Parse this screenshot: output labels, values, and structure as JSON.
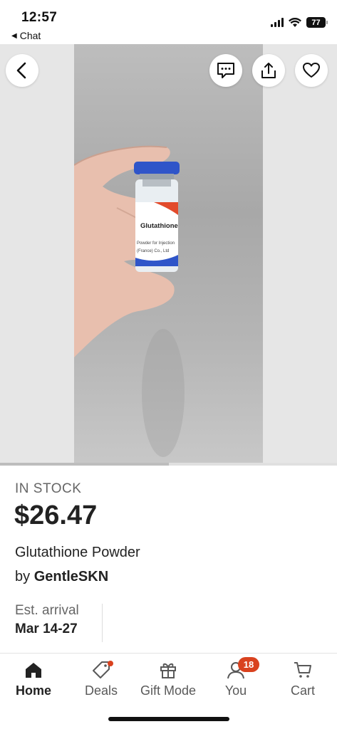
{
  "status_bar": {
    "time": "12:57",
    "back_app": "Chat",
    "battery": "77"
  },
  "hero": {
    "product_label": "Glutathione",
    "label_line1": "Powder for Injection",
    "label_line2": "(France) Co., Ltd",
    "image_progress": 0.5
  },
  "product": {
    "stock_status": "IN STOCK",
    "price": "$26.47",
    "title": "Glutathione Powder",
    "by": "by",
    "shop": "GentleSKN",
    "arrival_label": "Est. arrival",
    "arrival_date": "Mar 14-27"
  },
  "tabs": [
    {
      "label": "Home",
      "icon": "home-icon",
      "active": true
    },
    {
      "label": "Deals",
      "icon": "tag-icon"
    },
    {
      "label": "Gift Mode",
      "icon": "gift-icon"
    },
    {
      "label": "You",
      "icon": "user-icon",
      "badge": "18"
    },
    {
      "label": "Cart",
      "icon": "cart-icon"
    }
  ],
  "colors": {
    "accent": "#d9421f",
    "vial_cap": "#2f55c9"
  }
}
